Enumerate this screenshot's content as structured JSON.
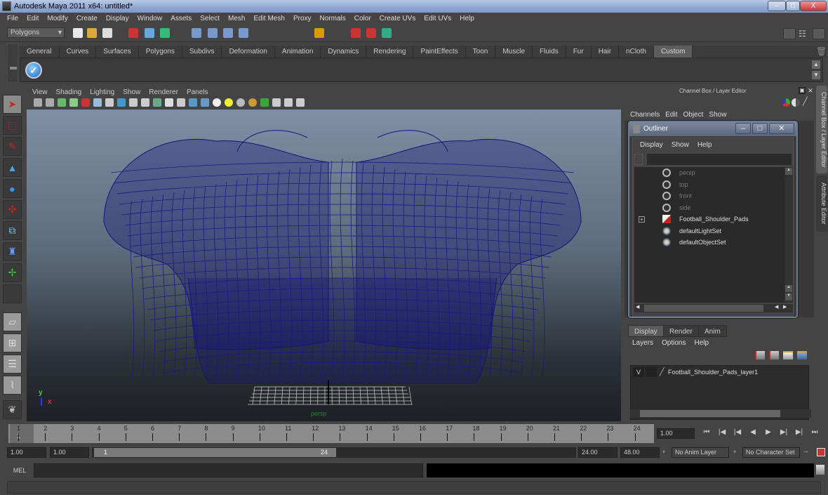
{
  "window": {
    "title": "Autodesk Maya 2011 x64: untitled*",
    "controls": {
      "minimize": "–",
      "maximize": "□",
      "close": "X"
    }
  },
  "menubar": [
    "File",
    "Edit",
    "Modify",
    "Create",
    "Display",
    "Window",
    "Assets",
    "Select",
    "Mesh",
    "Edit Mesh",
    "Proxy",
    "Normals",
    "Color",
    "Create UVs",
    "Edit UVs",
    "Help"
  ],
  "statusline": {
    "menu_set": "Polygons",
    "icons": [
      "new-scene-icon",
      "open-scene-icon",
      "save-scene-icon",
      "select-by-hierarchy-icon",
      "select-by-object-icon",
      "select-by-component-icon",
      "snap-grid-icon",
      "snap-curve-icon",
      "snap-point-icon",
      "snap-view-plane-icon",
      "make-live-icon",
      "render-icon",
      "ipr-render-icon",
      "render-settings-icon"
    ]
  },
  "shelf": {
    "tabs": [
      "General",
      "Curves",
      "Surfaces",
      "Polygons",
      "Subdivs",
      "Deformation",
      "Animation",
      "Dynamics",
      "Rendering",
      "PaintEffects",
      "Toon",
      "Muscle",
      "Fluids",
      "Fur",
      "Hair",
      "nCloth",
      "Custom"
    ],
    "active_tab": "Custom",
    "items": [
      "checkmark-icon"
    ]
  },
  "panel": {
    "menus": [
      "View",
      "Shading",
      "Lighting",
      "Show",
      "Renderer",
      "Panels"
    ],
    "camera_label": "persp",
    "axis": {
      "x": "x",
      "y": "y"
    }
  },
  "toolbox": [
    "select-tool",
    "lasso-tool",
    "paint-select-tool",
    "move-tool",
    "rotate-tool",
    "scale-tool",
    "universal-manipulator",
    "soft-mod-tool",
    "show-manipulator",
    "last-used-tool",
    "single-perspective-layout",
    "four-view-layout",
    "outliner-persp-layout",
    "graph-persp-layout",
    "mudbox-icon"
  ],
  "channelbox": {
    "header": "Channel Box / Layer Editor",
    "menus": [
      "Channels",
      "Edit",
      "Object",
      "Show"
    ],
    "side_tabs": [
      "Channel Box / Layer Editor",
      "Attribute Editor"
    ]
  },
  "outliner": {
    "title": "Outliner",
    "menus": [
      "Display",
      "Show",
      "Help"
    ],
    "items": [
      {
        "label": "persp",
        "type": "camera",
        "dim": true
      },
      {
        "label": "top",
        "type": "camera",
        "dim": true
      },
      {
        "label": "front",
        "type": "camera",
        "dim": true
      },
      {
        "label": "side",
        "type": "camera",
        "dim": true
      },
      {
        "label": "Football_Shoulder_Pads",
        "type": "mesh",
        "expandable": true,
        "expand_glyph": "+"
      },
      {
        "label": "defaultLightSet",
        "type": "set"
      },
      {
        "label": "defaultObjectSet",
        "type": "set"
      }
    ]
  },
  "layer_editor": {
    "tabs": [
      "Display",
      "Render",
      "Anim"
    ],
    "active_tab": "Display",
    "menus": [
      "Layers",
      "Options",
      "Help"
    ],
    "layers": [
      {
        "visible": "V",
        "name": "Football_Shoulder_Pads_layer1"
      }
    ]
  },
  "timeline": {
    "ticks": [
      "1",
      "2",
      "3",
      "4",
      "5",
      "6",
      "7",
      "8",
      "9",
      "10",
      "11",
      "12",
      "13",
      "14",
      "15",
      "16",
      "17",
      "18",
      "19",
      "20",
      "21",
      "22",
      "23",
      "24"
    ],
    "current_frame_marker": "1",
    "current_time": "1.00",
    "playback_buttons": [
      "go-to-start",
      "step-back-key",
      "step-back-frame",
      "play-backward",
      "play-forward",
      "step-forward-frame",
      "step-forward-key",
      "go-to-end"
    ]
  },
  "range": {
    "start_time": "1.00",
    "playback_start": "1.00",
    "range_slider_start": "1",
    "range_slider_end": "24",
    "playback_end": "24.00",
    "end_time": "48.00",
    "anim_layer": "No Anim Layer",
    "character_set": "No Character Set"
  },
  "command_line": {
    "label": "MEL",
    "value": ""
  },
  "colors": {
    "wireframe": "#1a1a7a",
    "accent": "#6c7b96"
  }
}
